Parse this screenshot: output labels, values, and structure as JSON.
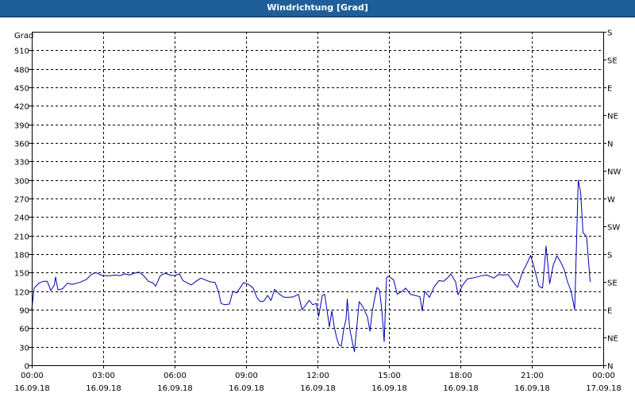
{
  "window": {
    "title": "Windrichtung [Grad]"
  },
  "chart_data": {
    "type": "line",
    "title": "Windrichtung [Grad]",
    "ylabel": "Grad",
    "ylim": [
      0,
      540
    ],
    "y_ticks": [
      0,
      30,
      60,
      90,
      120,
      150,
      180,
      210,
      240,
      270,
      300,
      330,
      360,
      390,
      420,
      450,
      480,
      510
    ],
    "y2_ticks": [
      {
        "value": 0,
        "label": "N"
      },
      {
        "value": 45,
        "label": "NE"
      },
      {
        "value": 90,
        "label": "E"
      },
      {
        "value": 135,
        "label": "SE"
      },
      {
        "value": 180,
        "label": "S"
      },
      {
        "value": 225,
        "label": "SW"
      },
      {
        "value": 270,
        "label": "W"
      },
      {
        "value": 315,
        "label": "NW"
      },
      {
        "value": 360,
        "label": "N"
      },
      {
        "value": 405,
        "label": "NE"
      },
      {
        "value": 450,
        "label": "E"
      },
      {
        "value": 495,
        "label": "SE"
      },
      {
        "value": 540,
        "label": "S"
      }
    ],
    "x_unit": "hours since 16.09.18 00:00",
    "xlim": [
      0,
      24
    ],
    "x_ticks": [
      {
        "value": 0,
        "time": "00:00",
        "date": "16.09.18"
      },
      {
        "value": 3,
        "time": "03:00",
        "date": "16.09.18"
      },
      {
        "value": 6,
        "time": "06:00",
        "date": "16.09.18"
      },
      {
        "value": 9,
        "time": "09:00",
        "date": "16.09.18"
      },
      {
        "value": 12,
        "time": "12:00",
        "date": "16.09.18"
      },
      {
        "value": 15,
        "time": "15:00",
        "date": "16.09.18"
      },
      {
        "value": 18,
        "time": "18:00",
        "date": "16.09.18"
      },
      {
        "value": 21,
        "time": "21:00",
        "date": "16.09.18"
      },
      {
        "value": 24,
        "time": "00:00",
        "date": "17.09.18"
      }
    ],
    "grid": true,
    "series": [
      {
        "color": "#0000b0",
        "points": [
          [
            0.0,
            90
          ],
          [
            0.1,
            125
          ],
          [
            0.3,
            133
          ],
          [
            0.5,
            136
          ],
          [
            0.65,
            136
          ],
          [
            0.8,
            121
          ],
          [
            0.95,
            130
          ],
          [
            1.0,
            143
          ],
          [
            1.1,
            122
          ],
          [
            1.3,
            124
          ],
          [
            1.5,
            133
          ],
          [
            1.7,
            131
          ],
          [
            2.0,
            134
          ],
          [
            2.3,
            139
          ],
          [
            2.5,
            147
          ],
          [
            2.7,
            150
          ],
          [
            2.9,
            146
          ],
          [
            3.1,
            145
          ],
          [
            3.3,
            145
          ],
          [
            3.5,
            146
          ],
          [
            3.7,
            145
          ],
          [
            3.9,
            148
          ],
          [
            4.1,
            146
          ],
          [
            4.3,
            149
          ],
          [
            4.5,
            151
          ],
          [
            4.7,
            145
          ],
          [
            4.9,
            136
          ],
          [
            5.1,
            133
          ],
          [
            5.2,
            128
          ],
          [
            5.4,
            145
          ],
          [
            5.6,
            149
          ],
          [
            5.8,
            146
          ],
          [
            6.0,
            145
          ],
          [
            6.2,
            148
          ],
          [
            6.35,
            137
          ],
          [
            6.5,
            134
          ],
          [
            6.7,
            130
          ],
          [
            6.9,
            136
          ],
          [
            7.1,
            141
          ],
          [
            7.3,
            138
          ],
          [
            7.5,
            135
          ],
          [
            7.7,
            134
          ],
          [
            7.85,
            118
          ],
          [
            7.95,
            100
          ],
          [
            8.1,
            98
          ],
          [
            8.3,
            99
          ],
          [
            8.45,
            120
          ],
          [
            8.6,
            117
          ],
          [
            8.9,
            134
          ],
          [
            9.1,
            131
          ],
          [
            9.3,
            125
          ],
          [
            9.45,
            110
          ],
          [
            9.6,
            103
          ],
          [
            9.75,
            104
          ],
          [
            9.9,
            113
          ],
          [
            10.05,
            105
          ],
          [
            10.2,
            123
          ],
          [
            10.4,
            115
          ],
          [
            10.6,
            110
          ],
          [
            10.8,
            110
          ],
          [
            11.0,
            111
          ],
          [
            11.2,
            115
          ],
          [
            11.35,
            90
          ],
          [
            11.5,
            97
          ],
          [
            11.65,
            105
          ],
          [
            11.8,
            98
          ],
          [
            11.95,
            100
          ],
          [
            12.05,
            79
          ],
          [
            12.2,
            113
          ],
          [
            12.3,
            115
          ],
          [
            12.4,
            89
          ],
          [
            12.5,
            62
          ],
          [
            12.6,
            88
          ],
          [
            12.7,
            63
          ],
          [
            12.8,
            45
          ],
          [
            12.9,
            33
          ],
          [
            13.0,
            31
          ],
          [
            13.1,
            58
          ],
          [
            13.2,
            75
          ],
          [
            13.25,
            107
          ],
          [
            13.35,
            60
          ],
          [
            13.45,
            40
          ],
          [
            13.55,
            22
          ],
          [
            13.65,
            62
          ],
          [
            13.75,
            103
          ],
          [
            13.9,
            95
          ],
          [
            14.1,
            78
          ],
          [
            14.2,
            55
          ],
          [
            14.3,
            87
          ],
          [
            14.4,
            108
          ],
          [
            14.5,
            126
          ],
          [
            14.6,
            122
          ],
          [
            14.7,
            90
          ],
          [
            14.8,
            38
          ],
          [
            14.9,
            142
          ],
          [
            15.0,
            144
          ],
          [
            15.2,
            138
          ],
          [
            15.35,
            115
          ],
          [
            15.6,
            121
          ],
          [
            15.7,
            125
          ],
          [
            15.9,
            115
          ],
          [
            16.1,
            113
          ],
          [
            16.3,
            111
          ],
          [
            16.4,
            88
          ],
          [
            16.5,
            120
          ],
          [
            16.7,
            110
          ],
          [
            16.9,
            127
          ],
          [
            17.1,
            137
          ],
          [
            17.3,
            136
          ],
          [
            17.5,
            143
          ],
          [
            17.6,
            148
          ],
          [
            17.8,
            135
          ],
          [
            17.9,
            114
          ],
          [
            18.1,
            130
          ],
          [
            18.3,
            140
          ],
          [
            18.5,
            141
          ],
          [
            18.7,
            143
          ],
          [
            18.9,
            145
          ],
          [
            19.1,
            146
          ],
          [
            19.3,
            143
          ],
          [
            19.4,
            141
          ],
          [
            19.6,
            147
          ],
          [
            19.8,
            146
          ],
          [
            20.0,
            147
          ],
          [
            20.2,
            136
          ],
          [
            20.4,
            126
          ],
          [
            20.6,
            150
          ],
          [
            20.8,
            165
          ],
          [
            20.95,
            178
          ],
          [
            21.1,
            158
          ],
          [
            21.3,
            128
          ],
          [
            21.45,
            125
          ],
          [
            21.6,
            193
          ],
          [
            21.75,
            132
          ],
          [
            21.9,
            162
          ],
          [
            22.05,
            177
          ],
          [
            22.2,
            168
          ],
          [
            22.35,
            156
          ],
          [
            22.5,
            135
          ],
          [
            22.65,
            120
          ],
          [
            22.8,
            90
          ],
          [
            22.95,
            300
          ],
          [
            23.05,
            280
          ],
          [
            23.15,
            215
          ],
          [
            23.3,
            208
          ],
          [
            23.45,
            135
          ]
        ]
      }
    ]
  }
}
